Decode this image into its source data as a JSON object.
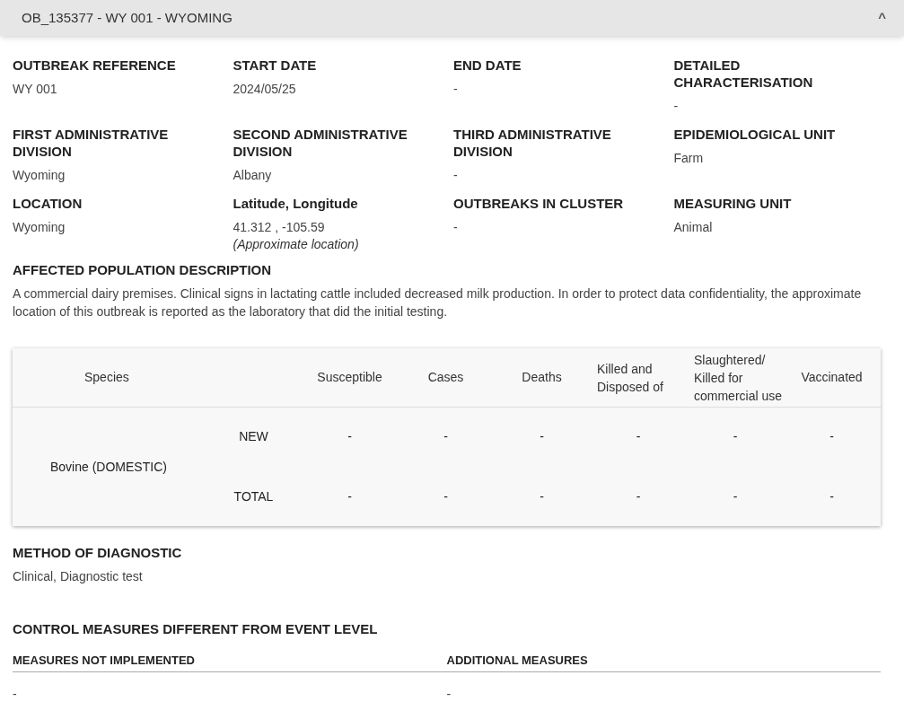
{
  "header": {
    "title": "OB_135377 - WY 001 - WYOMING",
    "expanded": true,
    "toggle_icon": "^"
  },
  "fields": [
    {
      "label": "OUTBREAK REFERENCE",
      "value": "WY 001"
    },
    {
      "label": "START DATE",
      "value": "2024/05/25"
    },
    {
      "label": "END DATE",
      "value": "-"
    },
    {
      "label": "DETAILED CHARACTERISATION",
      "value": "-"
    },
    {
      "label": "FIRST ADMINISTRATIVE DIVISION",
      "value": "Wyoming"
    },
    {
      "label": "SECOND ADMINISTRATIVE DIVISION",
      "value": "Albany"
    },
    {
      "label": "THIRD ADMINISTRATIVE DIVISION",
      "value": "-"
    },
    {
      "label": "EPIDEMIOLOGICAL UNIT",
      "value": "Farm"
    },
    {
      "label": "LOCATION",
      "value": "Wyoming"
    },
    {
      "label": "Latitude, Longitude",
      "value": "41.312 , -105.59",
      "note": "(Approximate location)"
    },
    {
      "label": "OUTBREAKS IN CLUSTER",
      "value": "-"
    },
    {
      "label": "MEASURING UNIT",
      "value": "Animal"
    }
  ],
  "population": {
    "label": "AFFECTED POPULATION DESCRIPTION",
    "text": "A commercial dairy premises. Clinical signs in lactating cattle included decreased milk production. In order to protect data confidentiality, the approximate location of this outbreak is reported as the laboratory that did the initial testing."
  },
  "table": {
    "columns": [
      "Species",
      "Susceptible",
      "Cases",
      "Deaths",
      "Killed and Disposed of",
      "Slaughtered/ Killed for commercial use",
      "Vaccinated"
    ],
    "rows": [
      {
        "species": "Bovine (DOMESTIC)",
        "lines": [
          {
            "type": "NEW",
            "values": [
              "-",
              "-",
              "-",
              "-",
              "-",
              "-"
            ]
          },
          {
            "type": "TOTAL",
            "values": [
              "-",
              "-",
              "-",
              "-",
              "-",
              "-"
            ]
          }
        ]
      }
    ]
  },
  "diagnostic": {
    "label": "METHOD OF DIAGNOSTIC",
    "value": "Clinical, Diagnostic test"
  },
  "control": {
    "title": "CONTROL MEASURES DIFFERENT FROM EVENT LEVEL",
    "columns": [
      {
        "label": "MEASURES NOT IMPLEMENTED",
        "value": "-"
      },
      {
        "label": "ADDITIONAL MEASURES",
        "value": "-"
      }
    ]
  }
}
